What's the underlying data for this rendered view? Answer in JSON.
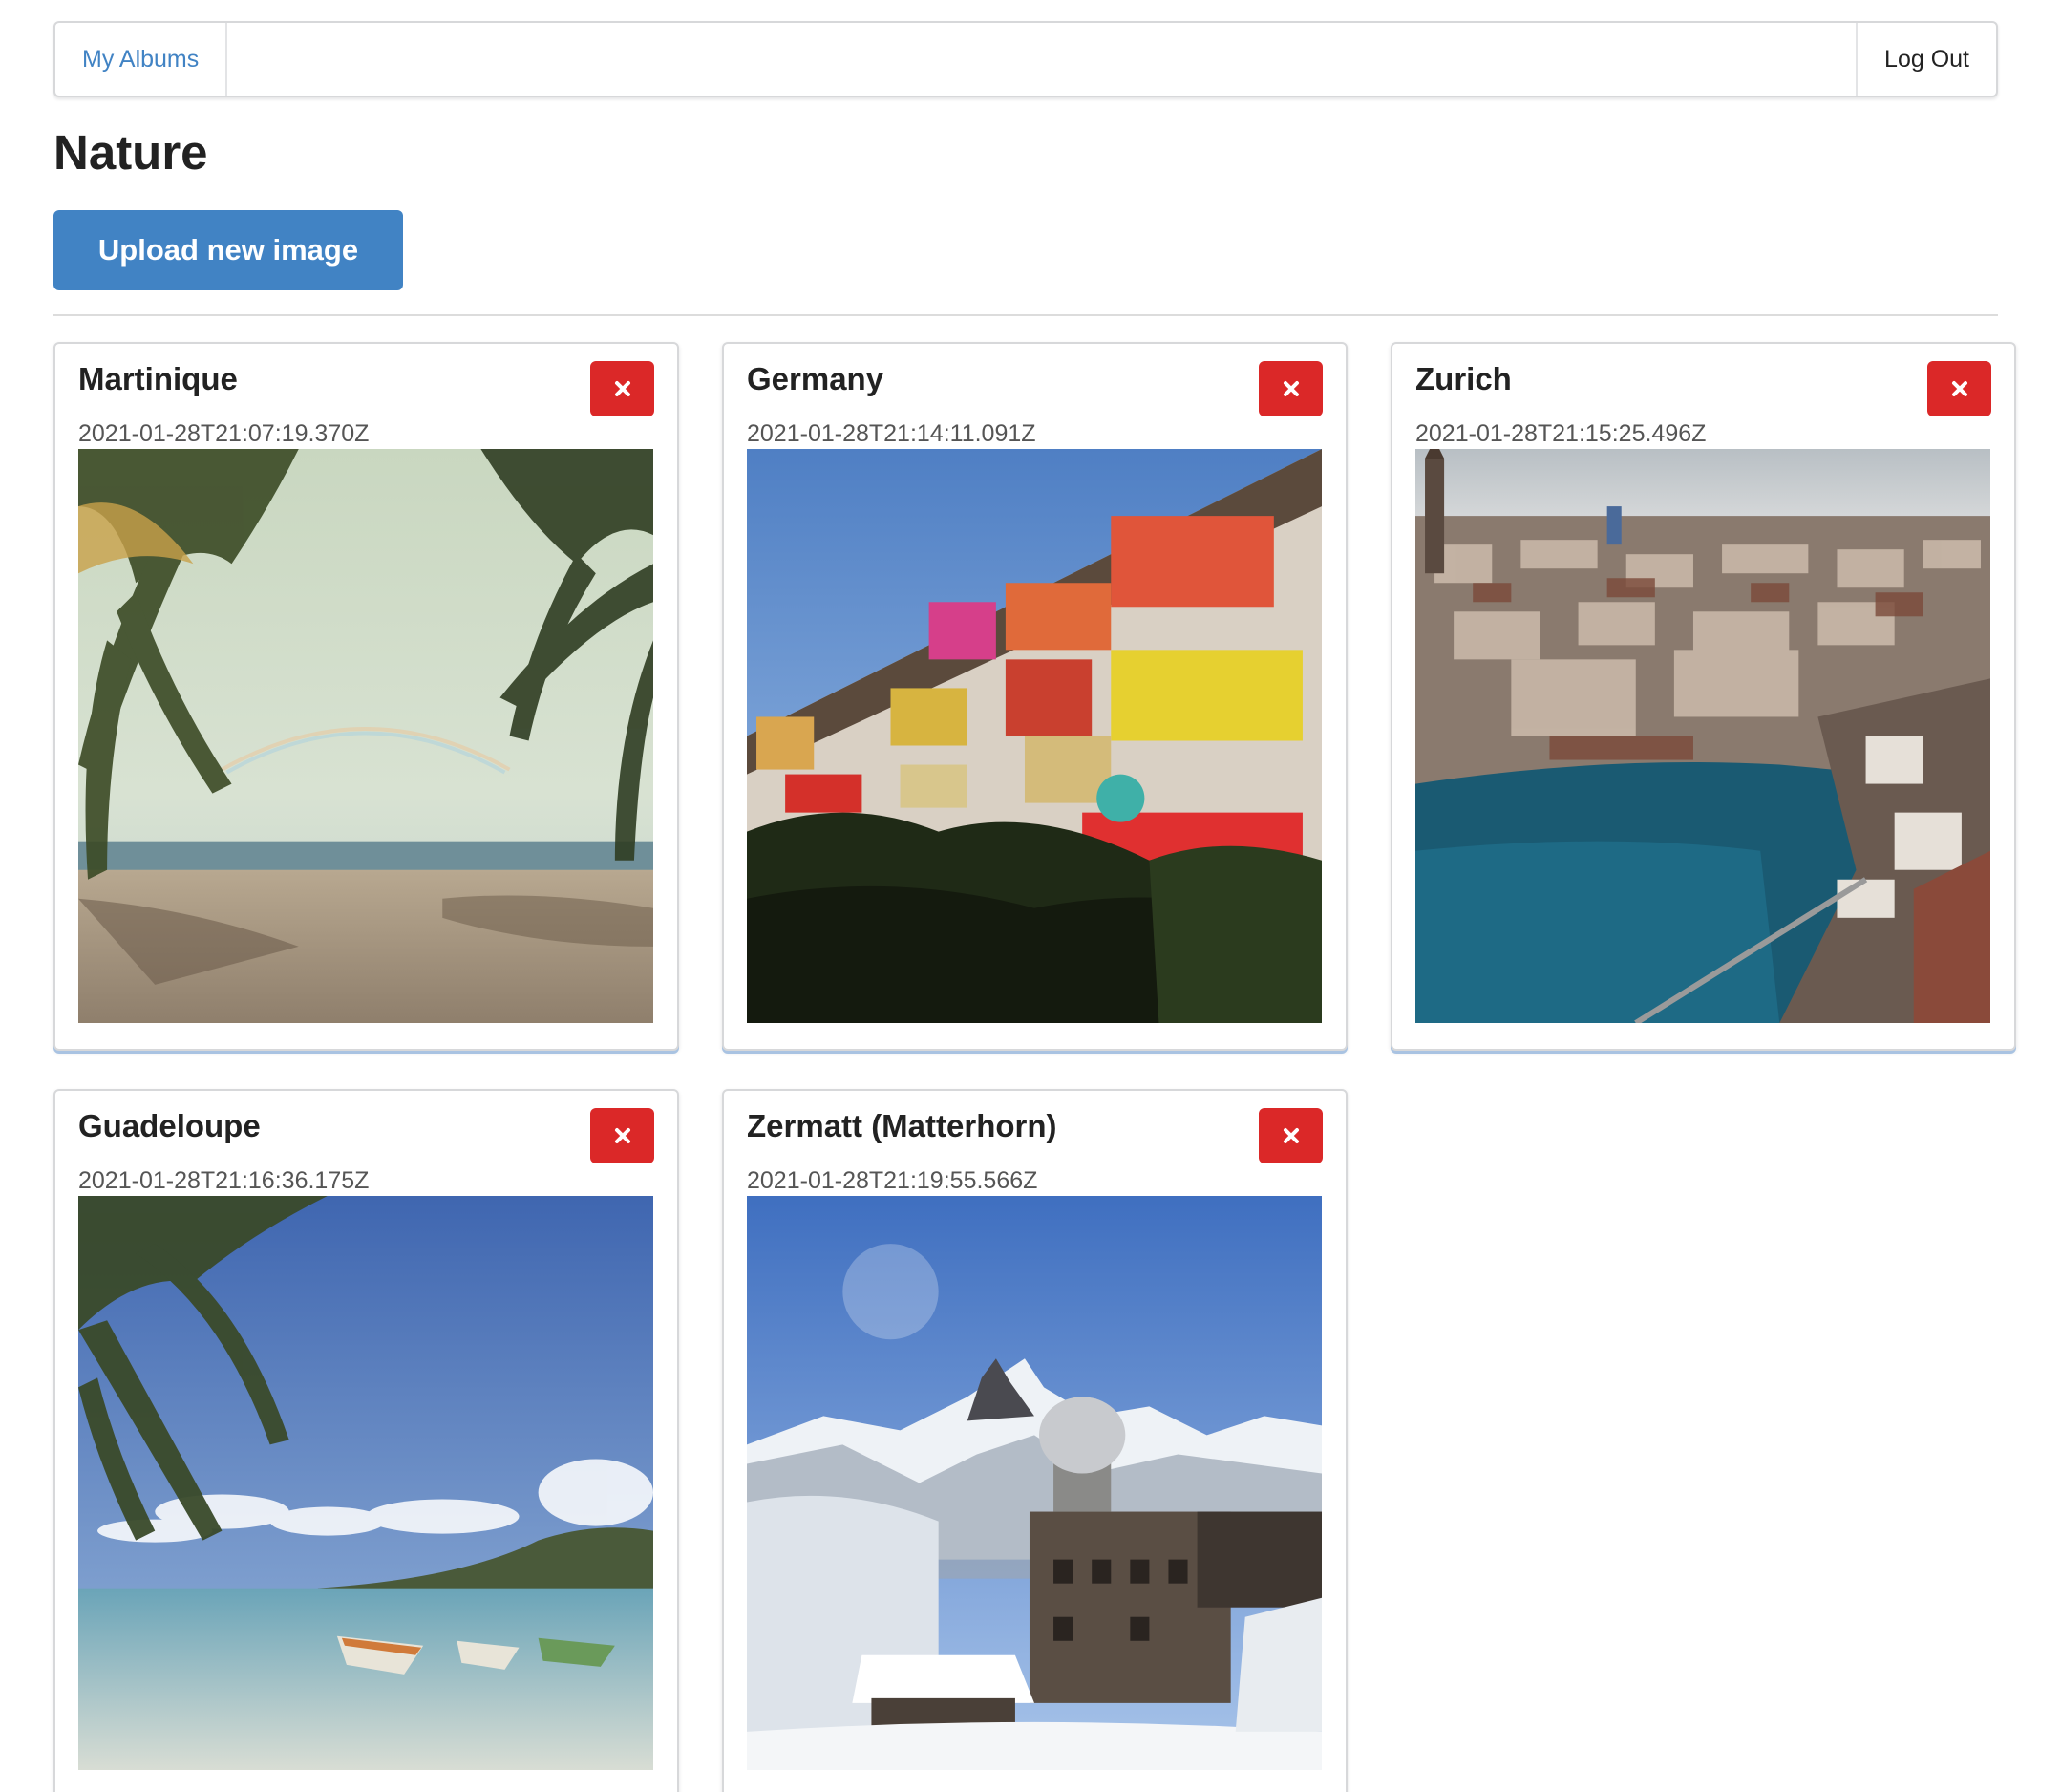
{
  "menu": {
    "albums_label": "My Albums",
    "logout_label": "Log Out"
  },
  "album": {
    "title": "Nature",
    "upload_label": "Upload new image"
  },
  "colors": {
    "accent": "#4183c4",
    "danger": "#db2828"
  },
  "images": [
    {
      "title": "Martinique",
      "date": "2021-01-28T21:07:19.370Z",
      "delete_icon": "close-icon"
    },
    {
      "title": "Germany",
      "date": "2021-01-28T21:14:11.091Z",
      "delete_icon": "close-icon"
    },
    {
      "title": "Zurich",
      "date": "2021-01-28T21:15:25.496Z",
      "delete_icon": "close-icon"
    },
    {
      "title": "Guadeloupe",
      "date": "2021-01-28T21:16:36.175Z",
      "delete_icon": "close-icon"
    },
    {
      "title": "Zermatt (Matterhorn)",
      "date": "2021-01-28T21:19:55.566Z",
      "delete_icon": "close-icon"
    }
  ]
}
